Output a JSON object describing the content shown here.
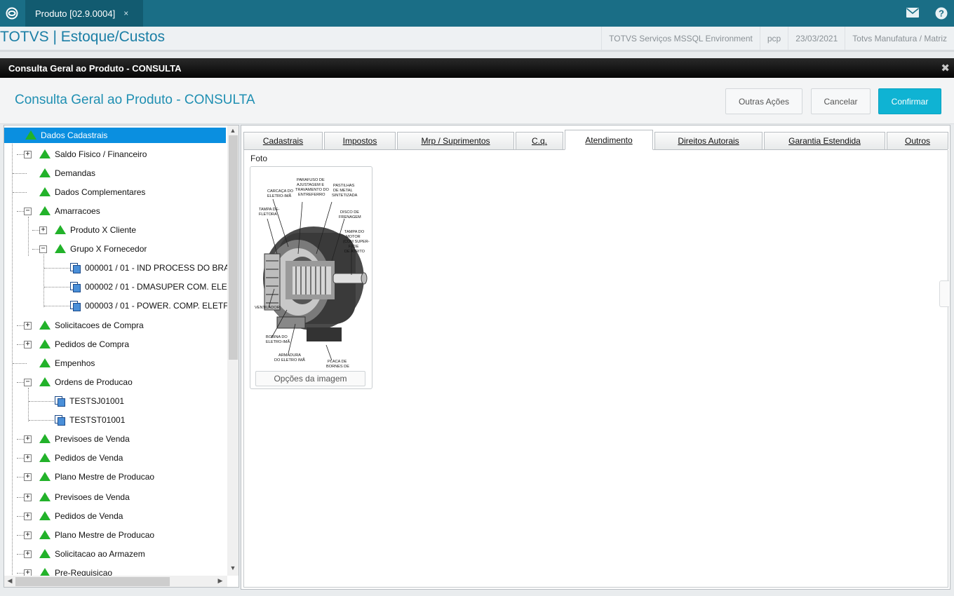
{
  "topbar": {
    "tab_label": "Produto [02.9.0004]",
    "tab_close": "×"
  },
  "module": {
    "title": "TOTVS | Estoque/Custos",
    "env": [
      "TOTVS Serviços MSSQL Environment",
      "pcp",
      "23/03/2021",
      "Totvs Manufatura / Matriz"
    ]
  },
  "dialog": {
    "bar_title": "Consulta Geral ao Produto - CONSULTA",
    "title": "Consulta Geral ao Produto - CONSULTA",
    "close_glyph": "✖",
    "buttons": {
      "outras": "Outras Ações",
      "cancelar": "Cancelar",
      "confirmar": "Confirmar"
    }
  },
  "tree": {
    "nodes": [
      {
        "label": "Dados Cadastrais"
      },
      {
        "label": "Saldo Fisico / Financeiro"
      },
      {
        "label": "Demandas"
      },
      {
        "label": "Dados Complementares"
      },
      {
        "label": "Amarracoes"
      },
      {
        "label": "Produto X Cliente"
      },
      {
        "label": "Grupo X Fornecedor"
      },
      {
        "label": "000001 / 01 - IND PROCESS DO BRA"
      },
      {
        "label": "000002 / 01 - DMASUPER COM. ELE"
      },
      {
        "label": "000003 / 01 - POWER. COMP. ELETF"
      },
      {
        "label": "Solicitacoes de Compra"
      },
      {
        "label": "Pedidos de Compra"
      },
      {
        "label": "Empenhos"
      },
      {
        "label": "Ordens de Producao"
      },
      {
        "label": "TESTSJ01001"
      },
      {
        "label": "TESTST01001"
      },
      {
        "label": "Previsoes de Venda"
      },
      {
        "label": "Pedidos de Venda"
      },
      {
        "label": "Plano Mestre de Producao"
      },
      {
        "label": "Previsoes de Venda"
      },
      {
        "label": "Pedidos de Venda"
      },
      {
        "label": "Plano Mestre de Producao"
      },
      {
        "label": "Solicitacao ao Armazem"
      },
      {
        "label": "Pre-Requisicao"
      }
    ]
  },
  "tabs": [
    "Cadastrais",
    "Impostos",
    "Mrp / Suprimentos",
    "C.q.",
    "Atendimento",
    "Direitos Autorais",
    "Garantia Estendida",
    "Outros"
  ],
  "active_tab": "Atendimento",
  "foto": {
    "label": "Foto",
    "options_button": "Opções da imagem",
    "image_labels": [
      "CARCAÇA DO ELETRO-IMÃ",
      "PARAFUSO DE AJUSTAGEM E TRAVAMENTO DO ENTREFERRO",
      "PASTILHAS DE METAL SINTETIZADA",
      "TAMPA DE-FLETORA",
      "DISCO DE FRENAGEM",
      "TAMPA DO MOTOR (COM SUPER-FÍCIE DE ATRITO",
      "VENTILADOR",
      "BOBINA DO ELETRO-IMÃ",
      "ARMADURA DO ELETRO IMÃ",
      "PLACA DE BORNES DE"
    ]
  },
  "colors": {
    "topbar": "#1a6e86",
    "accent": "#1f8fb2",
    "confirm": "#0fb3d3",
    "tree_selected": "#0a8fe0",
    "node_icon": "#22b22a"
  }
}
